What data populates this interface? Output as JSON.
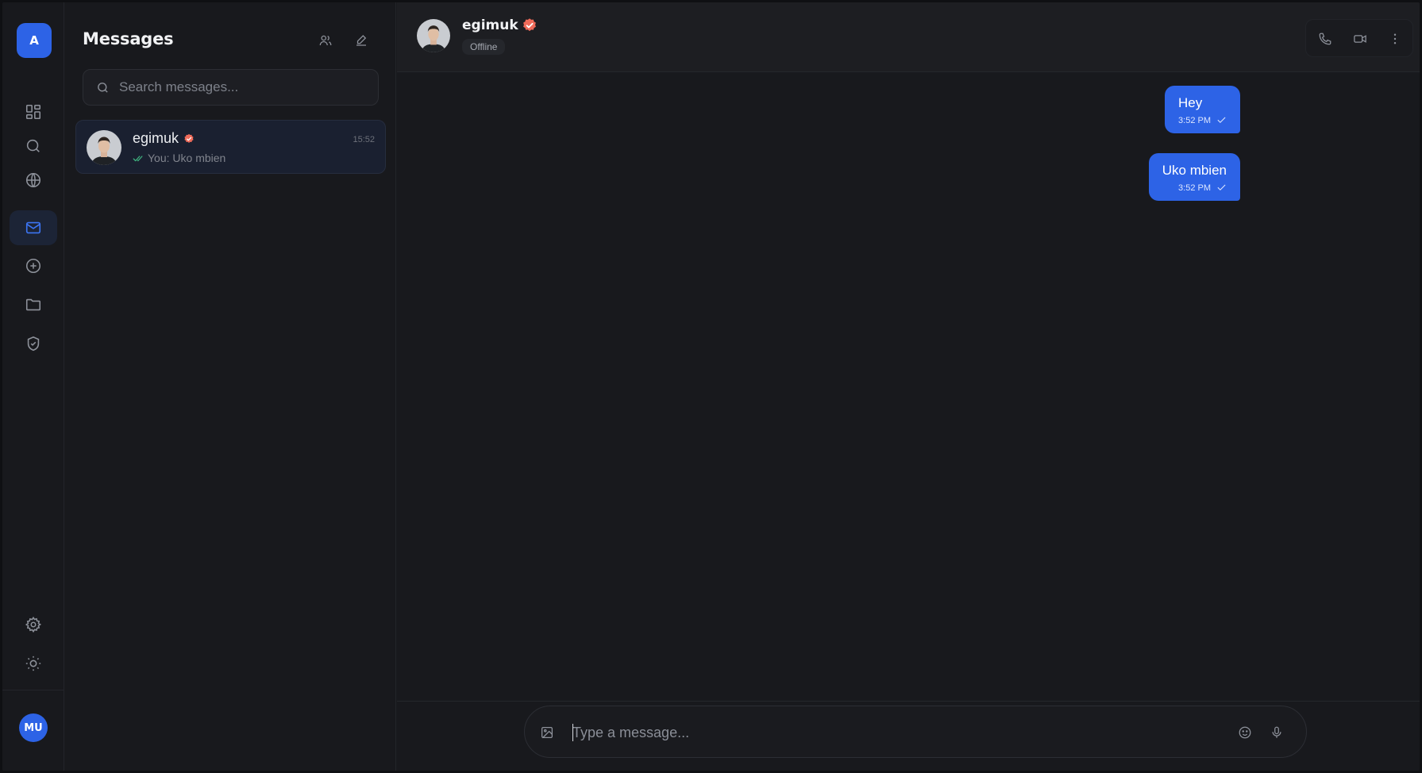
{
  "rail": {
    "brand_letter": "A",
    "items": [
      {
        "icon": "dashboard-icon",
        "active": false
      },
      {
        "icon": "search-icon",
        "active": false
      },
      {
        "icon": "globe-icon",
        "active": false
      },
      {
        "icon": "mail-icon",
        "active": true
      },
      {
        "icon": "plus-circle-icon",
        "active": false
      },
      {
        "icon": "folder-icon",
        "active": false
      },
      {
        "icon": "shield-check-icon",
        "active": false
      }
    ],
    "bottom_items": [
      {
        "icon": "settings-gear-icon"
      },
      {
        "icon": "sun-icon"
      }
    ],
    "user_initials": "MU"
  },
  "sidebar": {
    "title": "Messages",
    "search_placeholder": "Search messages...",
    "conversations": [
      {
        "name": "egimuk",
        "verified": true,
        "time": "15:52",
        "preview": "You: Uko mbien",
        "read": true,
        "selected": true
      }
    ]
  },
  "chat": {
    "contact_name": "egimuk",
    "verified": true,
    "status": "Offline",
    "messages": [
      {
        "text": "Hey",
        "time": "3:52 PM",
        "from_me": true,
        "delivered": true
      },
      {
        "text": "Uko mbien",
        "time": "3:52 PM",
        "from_me": true,
        "delivered": true
      }
    ],
    "composer_placeholder": "Type a message..."
  },
  "colors": {
    "accent": "#2d63e6",
    "verified_badge": "#ef6b5a",
    "read_check": "#3fb37f",
    "background": "#18191d"
  }
}
